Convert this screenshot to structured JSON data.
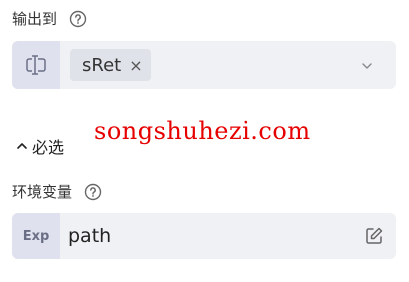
{
  "output": {
    "label": "输出到",
    "tag_label": "sRet",
    "tag_remove": "×",
    "help_icon": "question-circle-icon",
    "prefix_icon": "text-cursor-icon",
    "dropdown_icon": "chevron-down-icon"
  },
  "advanced": {
    "label": "必选",
    "caret_icon": "chevron-up-icon"
  },
  "watermark": "songshuhezi.com",
  "env": {
    "label": "环境变量",
    "help_icon": "question-circle-icon",
    "prefix": "Exp",
    "value": "path",
    "edit_icon": "edit-icon"
  },
  "colors": {
    "field_bg": "#f0f1f5",
    "prefix_bg": "#dfe2ee",
    "tag_bg": "#e0e2ea",
    "watermark": "#e60000"
  }
}
